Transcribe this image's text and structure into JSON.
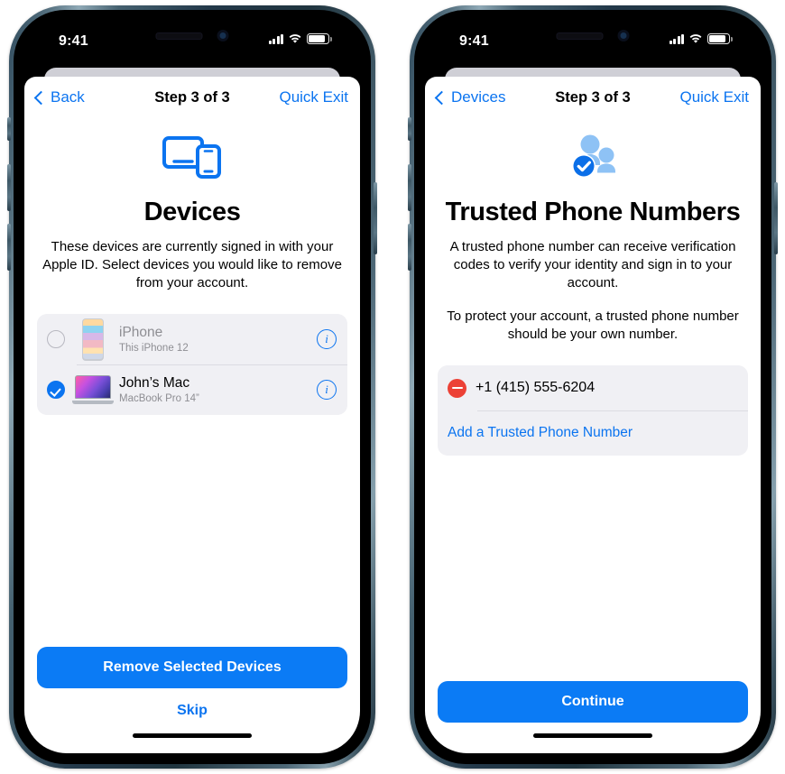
{
  "colors": {
    "accent_blue": "#0b74f0",
    "button_blue": "#0b7bf5",
    "delete_red": "#ec4136",
    "card_gray": "#f0f0f4",
    "secondary_text": "#8e8e93",
    "icon_light_blue": "#8ec2f5"
  },
  "left_phone": {
    "status_bar": {
      "time": "9:41",
      "cellular_icon": "signal-bars-icon",
      "wifi_icon": "wifi-icon",
      "battery_icon": "battery-icon"
    },
    "nav": {
      "back_label": "Back",
      "back_icon": "chevron-left-icon",
      "title": "Step 3 of 3",
      "quick_exit_label": "Quick Exit"
    },
    "hero_icon": "devices-laptop-phone-icon",
    "title": "Devices",
    "body": [
      "These devices are currently signed in with your Apple ID. Select devices you would like to remove from your account."
    ],
    "devices": [
      {
        "selected": false,
        "thumbnail": "iphone-thumbnail",
        "name": "iPhone",
        "subtitle": "This iPhone 12",
        "info_icon": "info-circle-icon"
      },
      {
        "selected": true,
        "thumbnail": "macbook-thumbnail",
        "name": "John’s Mac",
        "subtitle": "MacBook Pro 14”",
        "info_icon": "info-circle-icon"
      }
    ],
    "primary_button": "Remove Selected Devices",
    "secondary_button": "Skip"
  },
  "right_phone": {
    "status_bar": {
      "time": "9:41",
      "cellular_icon": "signal-bars-icon",
      "wifi_icon": "wifi-icon",
      "battery_icon": "battery-icon"
    },
    "nav": {
      "back_label": "Devices",
      "back_icon": "chevron-left-icon",
      "title": "Step 3 of 3",
      "quick_exit_label": "Quick Exit"
    },
    "hero_icon": "trusted-contacts-checkmark-icon",
    "title": "Trusted Phone Numbers",
    "body": [
      "A trusted phone number can receive verification codes to verify your identity and sign in to your account.",
      "To protect your account, a trusted phone number should be your own number."
    ],
    "phone_numbers": [
      {
        "delete_icon": "minus-circle-icon",
        "number": "+1 (415) 555-6204"
      }
    ],
    "add_number_label": "Add a Trusted Phone Number",
    "primary_button": "Continue"
  }
}
